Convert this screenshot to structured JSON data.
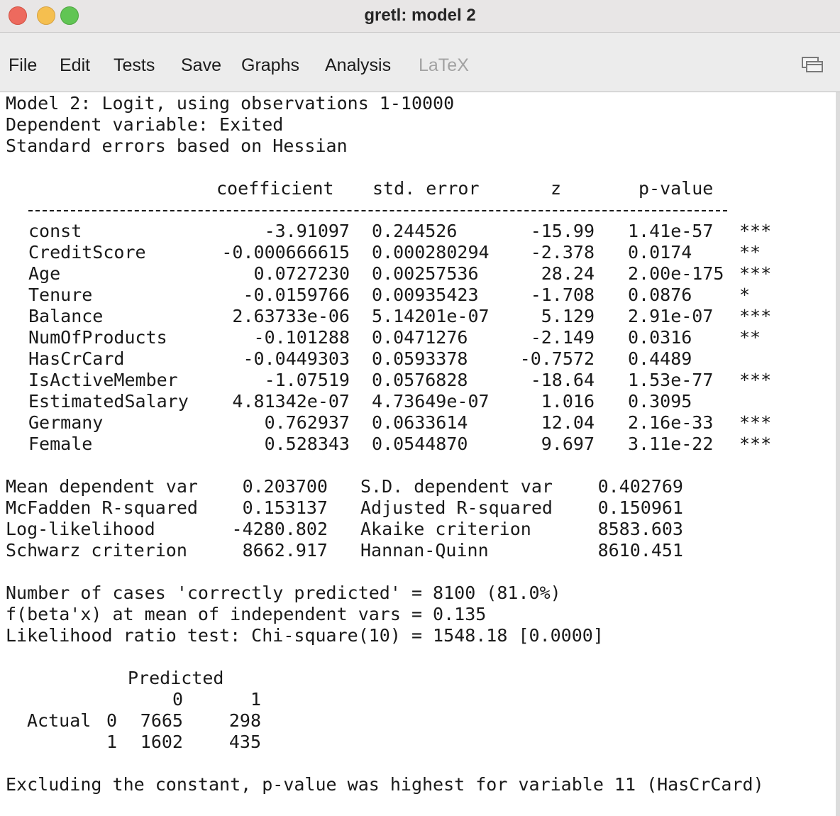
{
  "window": {
    "title": "gretl: model 2"
  },
  "menu": {
    "items": [
      "File",
      "Edit",
      "Tests",
      "Save",
      "Graphs",
      "Analysis",
      "LaTeX"
    ]
  },
  "output": {
    "header": [
      "Model 2: Logit, using observations 1-10000",
      "Dependent variable: Exited",
      "Standard errors based on Hessian"
    ],
    "columns": {
      "coefficient": "coefficient",
      "std_error": "std. error",
      "z": "z",
      "p_value": "p-value"
    },
    "rows": [
      {
        "name": "const",
        "coef": "-3.91097",
        "se": "0.244526",
        "z": "-15.99",
        "p": "1.41e-57",
        "stars": "***"
      },
      {
        "name": "CreditScore",
        "coef": "-0.000666615",
        "se": "0.000280294",
        "z": "-2.378",
        "p": "0.0174",
        "stars": "**"
      },
      {
        "name": "Age",
        "coef": "0.0727230",
        "se": "0.00257536",
        "z": "28.24",
        "p": "2.00e-175",
        "stars": "***"
      },
      {
        "name": "Tenure",
        "coef": "-0.0159766",
        "se": "0.00935423",
        "z": "-1.708",
        "p": "0.0876",
        "stars": "*"
      },
      {
        "name": "Balance",
        "coef": "2.63733e-06",
        "se": "5.14201e-07",
        "z": "5.129",
        "p": "2.91e-07",
        "stars": "***"
      },
      {
        "name": "NumOfProducts",
        "coef": "-0.101288",
        "se": "0.0471276",
        "z": "-2.149",
        "p": "0.0316",
        "stars": "**"
      },
      {
        "name": "HasCrCard",
        "coef": "-0.0449303",
        "se": "0.0593378",
        "z": "-0.7572",
        "p": "0.4489",
        "stars": ""
      },
      {
        "name": "IsActiveMember",
        "coef": "-1.07519",
        "se": "0.0576828",
        "z": "-18.64",
        "p": "1.53e-77",
        "stars": "***"
      },
      {
        "name": "EstimatedSalary",
        "coef": "4.81342e-07",
        "se": "4.73649e-07",
        "z": "1.016",
        "p": "0.3095",
        "stars": ""
      },
      {
        "name": "Germany",
        "coef": "0.762937",
        "se": "0.0633614",
        "z": "12.04",
        "p": "2.16e-33",
        "stars": "***"
      },
      {
        "name": "Female",
        "coef": "0.528343",
        "se": "0.0544870",
        "z": "9.697",
        "p": "3.11e-22",
        "stars": "***"
      }
    ],
    "stats": [
      {
        "label1": "Mean dependent var",
        "value1": "0.203700",
        "label2": "S.D. dependent var",
        "value2": "0.402769"
      },
      {
        "label1": "McFadden R-squared",
        "value1": "0.153137",
        "label2": "Adjusted R-squared",
        "value2": "0.150961"
      },
      {
        "label1": "Log-likelihood",
        "value1": "-4280.802",
        "label2": "Akaike criterion",
        "value2": "8583.603"
      },
      {
        "label1": "Schwarz criterion",
        "value1": "8662.917",
        "label2": "Hannan-Quinn",
        "value2": "8610.451"
      }
    ],
    "summary": [
      "Number of cases 'correctly predicted' = 8100 (81.0%)",
      "f(beta'x) at mean of independent vars = 0.135",
      "Likelihood ratio test: Chi-square(10) = 1548.18 [0.0000]"
    ],
    "confusion": {
      "predicted_label": "Predicted",
      "col_headers": [
        "0",
        "1"
      ],
      "actual_label": "Actual",
      "rows": [
        {
          "label": "0",
          "values": [
            "7665",
            "298"
          ]
        },
        {
          "label": "1",
          "values": [
            "1602",
            "435"
          ]
        }
      ]
    },
    "footer": "Excluding the constant, p-value was highest for variable 11 (HasCrCard)"
  }
}
